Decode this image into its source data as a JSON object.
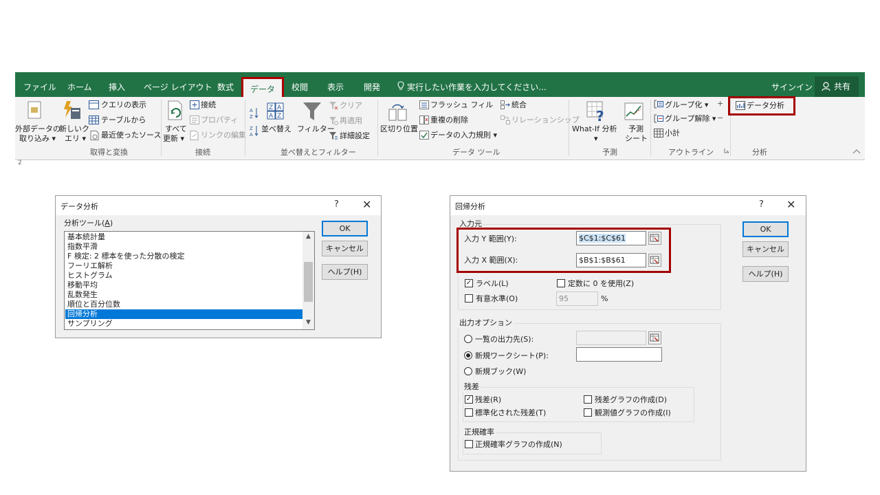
{
  "ribbon": {
    "tabs": [
      "ファイル",
      "ホーム",
      "挿入",
      "ページ レイアウト",
      "数式",
      "データ",
      "校閲",
      "表示",
      "開発"
    ],
    "active_tab": "データ",
    "tell_me": "実行したい作業を入力してください...",
    "sign_in": "サインイン",
    "share": "共有",
    "groups": {
      "get_transform": {
        "label": "取得と変換",
        "external_data": [
          "外部データの",
          "取り込み ▾"
        ],
        "new_query": [
          "新しいク",
          "エリ ▾"
        ],
        "show_query": "クエリの表示",
        "from_table": "テーブルから",
        "recent_sources": "最近使ったソース"
      },
      "connections": {
        "label": "接続",
        "refresh_all": [
          "すべて",
          "更新 ▾"
        ],
        "connections": "接続",
        "properties": "プロパティ",
        "edit_links": "リンクの編集"
      },
      "sort_filter": {
        "label": "並べ替えとフィルター",
        "sort": "並べ替え",
        "filter": "フィルター",
        "clear": "クリア",
        "reapply": "再適用",
        "advanced": "詳細設定"
      },
      "data_tools": {
        "label": "データ ツール",
        "text_to_columns": "区切り位置",
        "flash_fill": "フラッシュ フィル",
        "remove_duplicates": "重複の削除",
        "data_validation": "データの入力規則 ▾",
        "consolidate": "統合",
        "relationships": "リレーションシップ"
      },
      "forecast": {
        "label": "予測",
        "what_if": [
          "What-If 分析",
          "▾"
        ],
        "forecast_sheet": [
          "予測",
          "シート"
        ]
      },
      "outline": {
        "label": "アウトライン",
        "group": "グループ化 ▾",
        "ungroup": "グループ解除 ▾",
        "subtotal": "小計"
      },
      "analysis": {
        "label": "分析",
        "data_analysis": "データ分析"
      }
    },
    "row_header": "2"
  },
  "data_analysis_dialog": {
    "title": "データ分析",
    "help_glyph": "?",
    "close_glyph": "✕",
    "tools_label": "分析ツール(",
    "tools_key": "A",
    "tools_suffix": ")",
    "items": [
      "基本統計量",
      "指数平滑",
      "F 検定: 2 標本を使った分散の検定",
      "フーリエ解析",
      "ヒストグラム",
      "移動平均",
      "乱数発生",
      "順位と百分位数",
      "回帰分析",
      "サンプリング"
    ],
    "selected_index": 8,
    "ok": "OK",
    "cancel": "キャンセル",
    "help": "ヘルプ(H)"
  },
  "regression_dialog": {
    "title": "回帰分析",
    "help_glyph": "?",
    "close_glyph": "✕",
    "input_group": "入力元",
    "y_range_label": "入力 Y 範囲(Y):",
    "y_range_value": "$C$1:$C$61",
    "x_range_label": "入力 X 範囲(X):",
    "x_range_value": "$B$1:$B$61",
    "labels_label": "ラベル(L)",
    "labels_checked": true,
    "const_zero_label": "定数に 0 を使用(Z)",
    "const_zero_checked": false,
    "confidence_label": "有意水準(O)",
    "confidence_checked": false,
    "confidence_value": "95",
    "percent": "%",
    "output_group": "出力オプション",
    "output_range_label": "一覧の出力先(S):",
    "new_worksheet_label": "新規ワークシート(P):",
    "new_workbook_label": "新規ブック(W)",
    "selected_output": "新規ワークシート",
    "residuals_group": "残差",
    "residuals_label": "残差(R)",
    "residuals_checked": true,
    "standardized_label": "標準化された残差(T)",
    "standardized_checked": false,
    "residual_plots_label": "残差グラフの作成(D)",
    "residual_plots_checked": false,
    "line_fit_label": "観測値グラフの作成(I)",
    "line_fit_checked": false,
    "normal_group": "正規確率",
    "normal_plot_label": "正規確率グラフの作成(N)",
    "normal_plot_checked": false,
    "ok": "OK",
    "cancel": "キャンセル",
    "help": "ヘルプ(H)"
  },
  "colors": {
    "excel_green": "#217346",
    "highlight_red": "#a40000",
    "selection_blue": "#0078d7"
  }
}
